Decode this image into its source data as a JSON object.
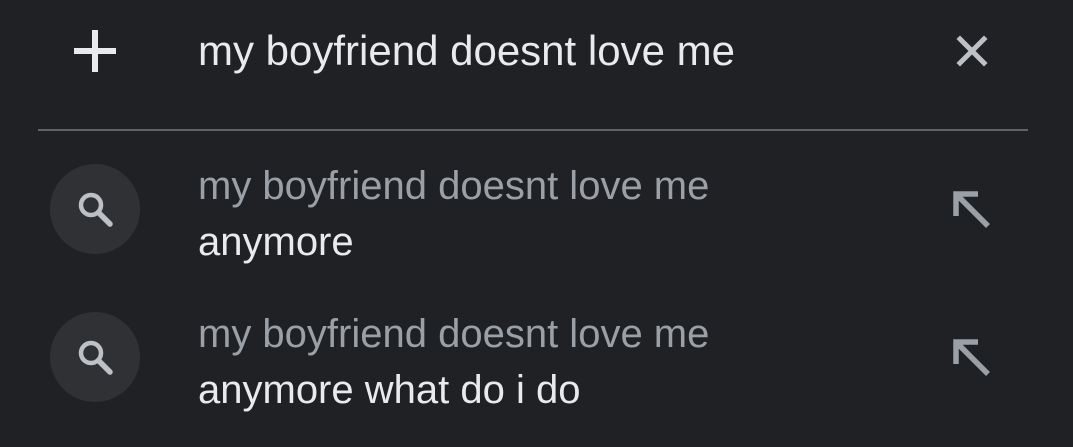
{
  "search": {
    "query": "my boyfriend doesnt love me"
  },
  "icons": {
    "add": "plus-icon",
    "clear": "close-icon",
    "search": "search-icon",
    "fill": "arrow-up-left-icon"
  },
  "colors": {
    "background": "#202124",
    "primary_text": "#e8eaed",
    "secondary_text": "#9aa0a6",
    "icon_circle": "#303134",
    "divider": "#5f6368"
  },
  "suggestions": [
    {
      "prefix": "my boyfriend doesnt love me",
      "completion": "anymore"
    },
    {
      "prefix": "my boyfriend doesnt love me",
      "completion": "anymore what do i do"
    }
  ]
}
